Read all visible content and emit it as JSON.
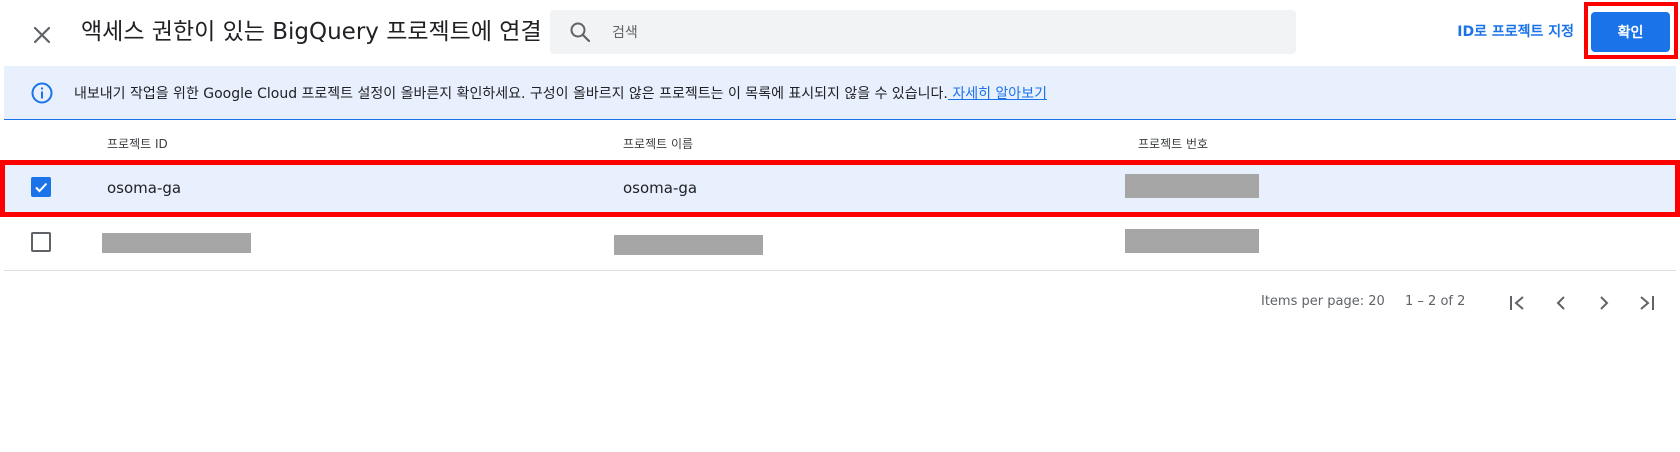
{
  "header": {
    "title": "액세스 권한이 있는 BigQuery 프로젝트에 연결",
    "search_placeholder": "검색",
    "search_value": "",
    "id_link": "ID로 프로젝트 지정",
    "confirm_label": "확인",
    "accent_color": "#1a73e8"
  },
  "banner": {
    "text": "내보내기 작업을 위한 Google Cloud 프로젝트 설정이 올바른지 확인하세요. 구성이 올바르지 않은 프로젝트는 이 목록에 표시되지 않을 수 있습니다.",
    "link": " 자세히 알아보기",
    "icon": "info-icon"
  },
  "table": {
    "columns": [
      "프로젝트 ID",
      "프로젝트 이름",
      "프로젝트 번호"
    ],
    "rows": [
      {
        "id": "osoma-ga",
        "name": "osoma-ga",
        "number": "",
        "checked": true
      },
      {
        "id": "",
        "name": "",
        "number": "",
        "checked": false
      }
    ]
  },
  "pagination": {
    "items_per_page": "Items per page: 20",
    "range": "1 – 2 of 2"
  },
  "icons": {
    "close": "close-icon",
    "search": "search-icon",
    "first_page": "first-page-icon",
    "prev_page": "chevron-left-icon",
    "next_page": "chevron-right-icon",
    "last_page": "last-page-icon"
  }
}
